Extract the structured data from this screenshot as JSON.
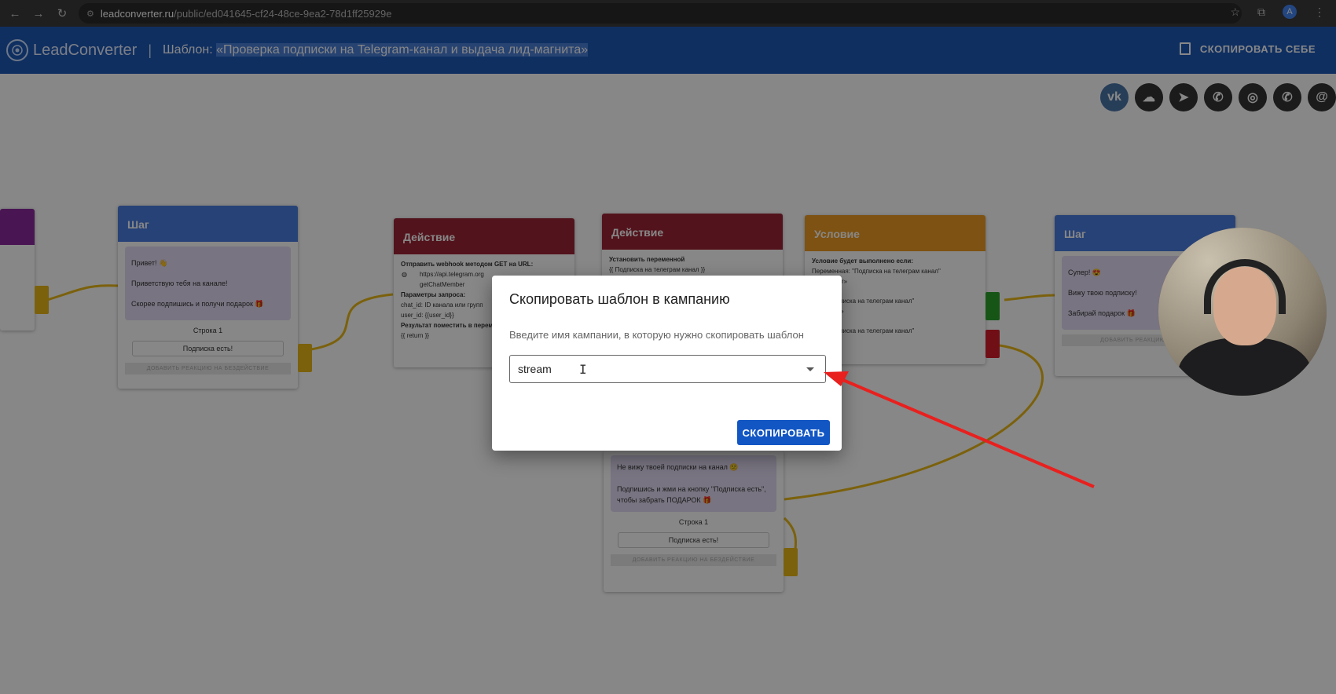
{
  "browser": {
    "url_domain": "leadconverter.ru",
    "url_path": "/public/ed041645-cf24-48ce-9ea2-78d1ff25929e",
    "profile_initial": "A"
  },
  "header": {
    "logo_text": "LeadConverter",
    "separator": "|",
    "template_prefix": "Шаблон: ",
    "template_name": "«Проверка подписки на Telegram-канал и выдача лид-магнита»",
    "copy_self_label": "СКОПИРОВАТЬ СЕБЕ"
  },
  "social_icons": [
    "vk-icon",
    "messenger-icon",
    "telegram-icon",
    "viber-icon",
    "instagram-icon",
    "whatsapp-icon",
    "email-icon"
  ],
  "nodes": {
    "step1": {
      "title": "Шаг",
      "messages": [
        "Привет! 👋",
        "Приветствую тебя на канале!",
        "Скорее подпишись и получи подарок 🎁"
      ],
      "row": "Строка 1",
      "button": "Подписка есть!",
      "add_reaction": "ДОБАВИТЬ РЕАКЦИЮ НА БЕЗДЕЙСТВИЕ"
    },
    "action1": {
      "title": "Действие",
      "line1": "Отправить webhook методом GET на URL:",
      "url": "https://api.telegram.org",
      "method": "getChatMember",
      "params_label": "Параметры запроса:",
      "param1": "chat_id: ID канала или групп",
      "param2": "user_id: {{user_id}}",
      "result_label": "Результат поместить в перемен",
      "return": "{{ return }}"
    },
    "action2": {
      "title": "Действие",
      "line1": "Установить переменной",
      "var": "{{ Подписка на телеграм канал }}"
    },
    "condition": {
      "title": "Условие",
      "line1": "Условие будет выполнено если:",
      "line2": "Переменная: \"Подписка на телеграм канал\"",
      "line3": "= «member»",
      "line4": "ная: \"Подписка на телеграм канал\"",
      "line5": "= «creator»",
      "line6": "ная: \"Подписка на телеграм канал\"",
      "line7": "= «admin»"
    },
    "step2": {
      "title": "Шаг",
      "messages": [
        "Супер! 😍",
        "Вижу твою подписку!",
        "Забирай подарок 🎁"
      ],
      "add_reaction": "ДОБАВИТЬ РЕАКЦИЮ НА БЕЗ"
    },
    "step3": {
      "messages": [
        "Не вижу твоей подписки на канал 😕",
        "Подпишись и жми на кнопку \"Подписка есть\", чтобы забрать ПОДАРОК 🎁"
      ],
      "row": "Строка 1",
      "button": "Подписка есть!",
      "add_reaction": "ДОБАВИТЬ РЕАКЦИЮ НА БЕЗДЕЙСТВИЕ"
    }
  },
  "dialog": {
    "title": "Скопировать шаблон в кампанию",
    "description": "Введите имя кампании, в которую нужно скопировать шаблон",
    "input_value": "stream",
    "submit_label": "СКОПИРОВАТЬ"
  },
  "colors": {
    "header_blue": "#1e5ab8",
    "step_blue": "#4a7de0",
    "action_red": "#9e2536",
    "condition_orange": "#ee9b22",
    "button_blue": "#1256c4",
    "annotation_arrow": "#e8201e"
  }
}
